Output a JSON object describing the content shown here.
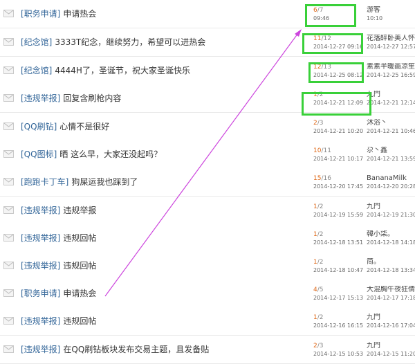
{
  "accent": {
    "highlight": "#39d039",
    "arrow": "#cc44dd",
    "category": "#336699",
    "reply": "#e06a1a"
  },
  "threads": [
    {
      "category": "[职务申请]",
      "subject": "申请热会",
      "replies": "6",
      "views": "7",
      "date": "09:46",
      "last_user": "游客",
      "last_time": "10:10"
    },
    {
      "category": "[纪念馆]",
      "subject": "3333T纪念，继续努力，希望可以进热会",
      "replies": "11",
      "views": "12",
      "date": "2014-12-27 09:16",
      "last_user": "花落醉卧美人怀",
      "last_time": "2014-12-27 12:57"
    },
    {
      "category": "[纪念馆]",
      "subject": "4444H了，圣诞节，祝大家圣诞快乐",
      "replies": "12",
      "views": "13",
      "date": "2014-12-25 08:12",
      "last_user": "素素半暖画凉笙",
      "last_time": "2014-12-25 16:59"
    },
    {
      "category": "[违规举报]",
      "subject": "回复含刷枪内容",
      "replies": "1",
      "views": "2",
      "date": "2014-12-21 12:09",
      "last_user": "九門",
      "last_time": "2014-12-21 12:14"
    },
    {
      "category": "[QQ刷钻]",
      "subject": "心情不是很好",
      "replies": "2",
      "views": "3",
      "date": "2014-12-21 10:20",
      "last_user": "沐浴丶",
      "last_time": "2014-12-21 10:46"
    },
    {
      "category": "[QQ图标]",
      "subject": "晒 这么早，大家还没起吗？",
      "replies": "10",
      "views": "11",
      "date": "2014-12-21 10:17",
      "last_user": "尕丶鑫",
      "last_time": "2014-12-21 13:59"
    },
    {
      "category": "[跑跑卡丁车]",
      "subject": "狗屎运我也踩到了",
      "replies": "15",
      "views": "16",
      "date": "2014-12-20 17:45",
      "last_user": "BananaMilk",
      "last_time": "2014-12-20 20:28"
    },
    {
      "category": "[违规举报]",
      "subject": "违规举报",
      "replies": "1",
      "views": "2",
      "date": "2014-12-19 15:59",
      "last_user": "九門",
      "last_time": "2014-12-19 21:30"
    },
    {
      "category": "[违规举报]",
      "subject": "违规回帖",
      "replies": "1",
      "views": "2",
      "date": "2014-12-18 13:51",
      "last_user": "韓小柒。",
      "last_time": "2014-12-18 14:18"
    },
    {
      "category": "[违规举报]",
      "subject": "违规回帖",
      "replies": "1",
      "views": "2",
      "date": "2014-12-18 10:47",
      "last_user": "简。",
      "last_time": "2014-12-18 13:34"
    },
    {
      "category": "[职务申请]",
      "subject": "申请热会",
      "replies": "4",
      "views": "5",
      "date": "2014-12-17 15:13",
      "last_user": "大混胸午夜狂倩",
      "last_time": "2014-12-17 17:18"
    },
    {
      "category": "[违规举报]",
      "subject": "违规回帖",
      "replies": "1",
      "views": "2",
      "date": "2014-12-16 16:15",
      "last_user": "九門",
      "last_time": "2014-12-16 17:04"
    },
    {
      "category": "[违规举报]",
      "subject": "在QQ刷钻板块发布交易主题，且发备贴",
      "replies": "2",
      "views": "3",
      "date": "2014-12-15 10:53",
      "last_user": "九門",
      "last_time": "2014-12-15 11:20"
    }
  ]
}
